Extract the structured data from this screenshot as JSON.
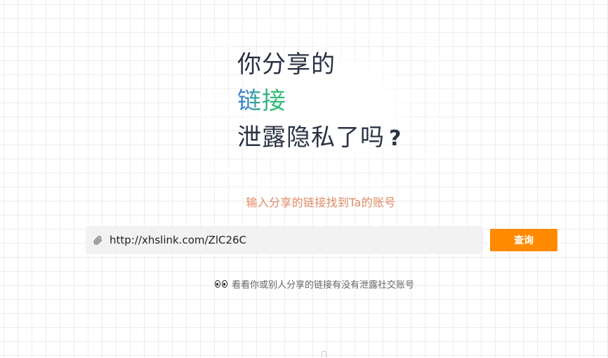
{
  "hero": {
    "line1": "你分享的",
    "line2": "链接",
    "line3": "泄露隐私了吗",
    "question_mark": "?",
    "gradient_colors": [
      "#3d7bd8",
      "#2fc073"
    ]
  },
  "subtitle": "输入分享的链接找到Ta的账号",
  "search": {
    "value": "http://xhslink.com/ZlC26C",
    "icon": "paperclip-icon"
  },
  "query_button": {
    "label": "查询",
    "color": "#ff8a00"
  },
  "hint": {
    "icon": "eyes-icon",
    "text": "看看你或别人分享的链接有没有泄露社交账号"
  },
  "colors": {
    "title": "#2a3344",
    "subtitle": "#e08a66",
    "hint": "#666666"
  }
}
